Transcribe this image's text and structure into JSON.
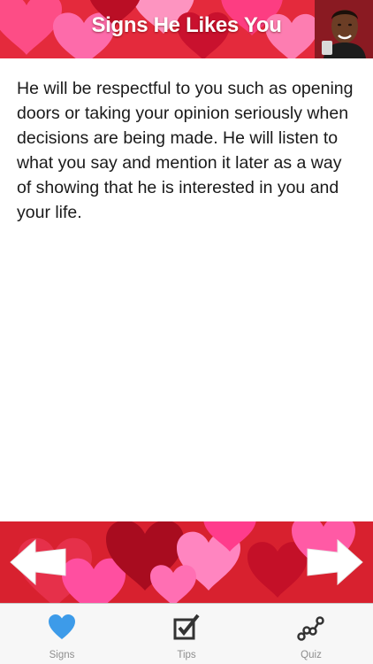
{
  "header": {
    "title": "Signs He Likes You",
    "background_color": "#e8223a"
  },
  "content": {
    "body_text": "He will be respectful to you such as opening doors or taking your opinion seriously when decisions are being made. He will listen to what you say and mention it later as a way of showing that he is interested in you and your life."
  },
  "navigation": {
    "prev_icon": "left-arrow-icon",
    "next_icon": "right-arrow-icon"
  },
  "tabbar": {
    "items": [
      {
        "label": "Signs",
        "icon": "heart-icon",
        "active": true,
        "color": "#3d9be9"
      },
      {
        "label": "Tips",
        "icon": "checkbox-icon",
        "active": false,
        "color": "#333333"
      },
      {
        "label": "Quiz",
        "icon": "quiz-graph-icon",
        "active": false,
        "color": "#333333"
      }
    ]
  }
}
